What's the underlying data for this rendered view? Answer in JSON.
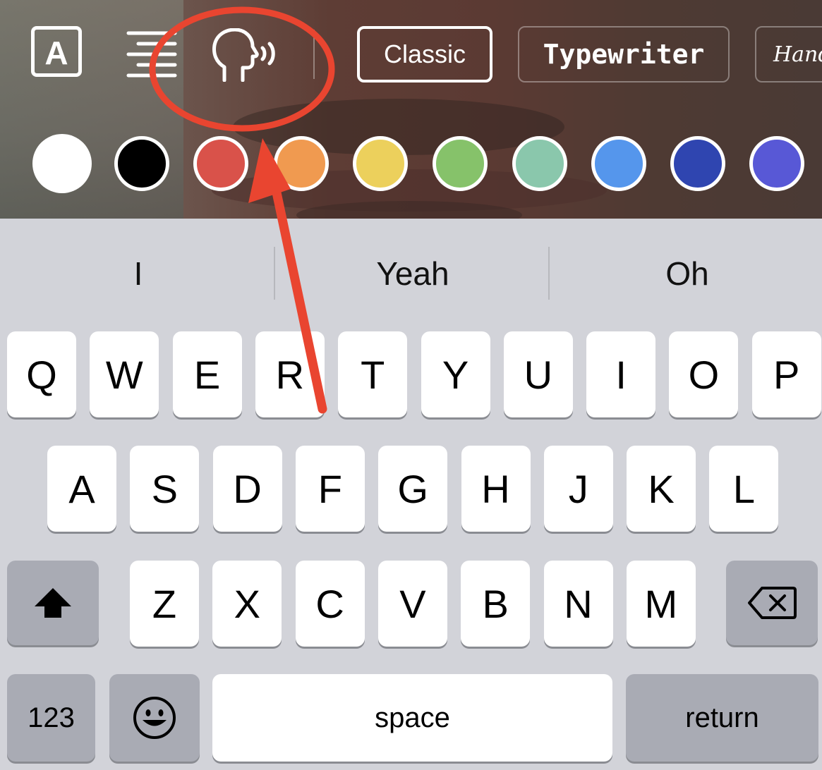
{
  "toolbar": {
    "font_icon_glyph": "A",
    "styles": [
      "Classic",
      "Typewriter",
      "Handw"
    ]
  },
  "colors": [
    "#ffffff",
    "#000000",
    "#d9524a",
    "#f09a50",
    "#ecd05c",
    "#86c26a",
    "#8ac7ac",
    "#5596ec",
    "#2f45b0",
    "#5858d6"
  ],
  "suggestions": [
    "I",
    "Yeah",
    "Oh"
  ],
  "keyboard": {
    "row1": [
      "Q",
      "W",
      "E",
      "R",
      "T",
      "Y",
      "U",
      "I",
      "O",
      "P"
    ],
    "row2": [
      "A",
      "S",
      "D",
      "F",
      "G",
      "H",
      "J",
      "K",
      "L"
    ],
    "row3": [
      "Z",
      "X",
      "C",
      "V",
      "B",
      "N",
      "M"
    ],
    "numbers_label": "123",
    "space_label": "space",
    "return_label": "return"
  },
  "annotation": {
    "color": "#e94530",
    "target": "voice-effect-icon"
  }
}
